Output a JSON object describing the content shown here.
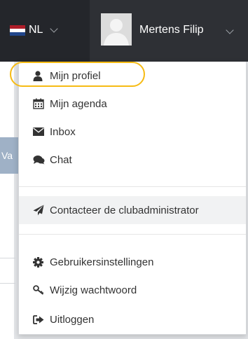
{
  "header": {
    "language_label": "NL",
    "user_name": "Mertens Filip",
    "flag_colors": [
      "#ae1c28",
      "#ffffff",
      "#21468b"
    ]
  },
  "background": {
    "tab_fragment": "Va"
  },
  "menu": {
    "items": [
      {
        "label": "Mijn profiel",
        "icon": "user-icon"
      },
      {
        "label": "Mijn agenda",
        "icon": "calendar-icon"
      },
      {
        "label": "Inbox",
        "icon": "envelope-icon"
      },
      {
        "label": "Chat",
        "icon": "comments-icon"
      },
      {
        "label": "Contacteer de clubadministrator",
        "icon": "paper-plane-icon"
      },
      {
        "label": "Gebruikersinstellingen",
        "icon": "gear-icon"
      },
      {
        "label": "Wijzig wachtwoord",
        "icon": "key-icon"
      },
      {
        "label": "Uitloggen",
        "icon": "sign-out-icon"
      }
    ],
    "highlight_color": "#f6bb14"
  }
}
